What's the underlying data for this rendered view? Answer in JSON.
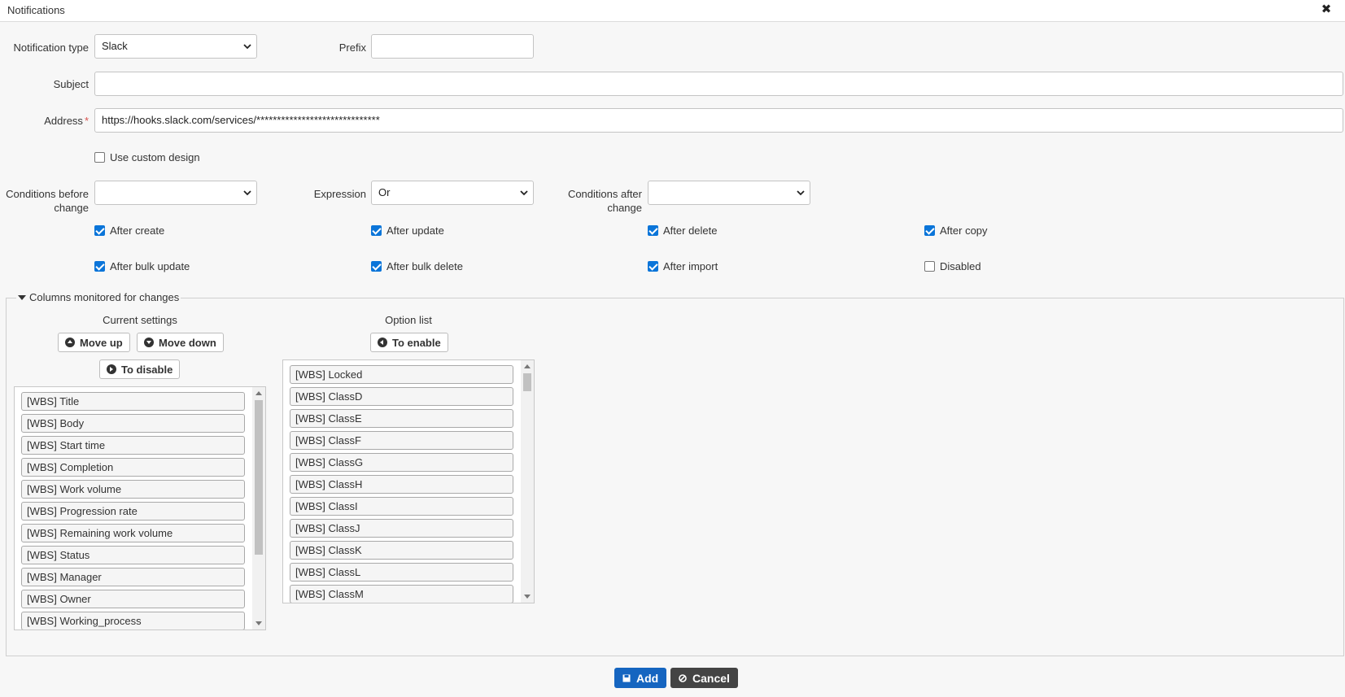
{
  "dialog": {
    "title": "Notifications",
    "close_icon": "close-icon"
  },
  "form": {
    "notification_type": {
      "label": "Notification type",
      "value": "Slack"
    },
    "prefix": {
      "label": "Prefix",
      "value": ""
    },
    "subject": {
      "label": "Subject",
      "value": ""
    },
    "address": {
      "label": "Address",
      "required_mark": "*",
      "value": "https://hooks.slack.com/services/******************************"
    },
    "custom_design": {
      "label": "Use custom design",
      "checked": false
    },
    "conditions_before": {
      "label_line1": "Conditions before",
      "label_line2": "change",
      "value": ""
    },
    "expression": {
      "label": "Expression",
      "value": "Or"
    },
    "conditions_after": {
      "label_line1": "Conditions after",
      "label_line2": "change",
      "value": ""
    },
    "triggers": [
      {
        "label": "After create",
        "checked": true
      },
      {
        "label": "After update",
        "checked": true
      },
      {
        "label": "After delete",
        "checked": true
      },
      {
        "label": "After copy",
        "checked": true
      },
      {
        "label": "After bulk update",
        "checked": true
      },
      {
        "label": "After bulk delete",
        "checked": true
      },
      {
        "label": "After import",
        "checked": true
      },
      {
        "label": "Disabled",
        "checked": false
      }
    ]
  },
  "columns": {
    "legend": "Columns monitored for changes",
    "current": {
      "caption": "Current settings",
      "move_up": "Move up",
      "move_down": "Move down",
      "to_disable": "To disable",
      "items": [
        "[WBS] Title",
        "[WBS] Body",
        "[WBS] Start time",
        "[WBS] Completion",
        "[WBS] Work volume",
        "[WBS] Progression rate",
        "[WBS] Remaining work volume",
        "[WBS] Status",
        "[WBS] Manager",
        "[WBS] Owner",
        "[WBS] Working_process"
      ]
    },
    "options": {
      "caption": "Option list",
      "to_enable": "To enable",
      "items": [
        "[WBS] Locked",
        "[WBS] ClassD",
        "[WBS] ClassE",
        "[WBS] ClassF",
        "[WBS] ClassG",
        "[WBS] ClassH",
        "[WBS] ClassI",
        "[WBS] ClassJ",
        "[WBS] ClassK",
        "[WBS] ClassL",
        "[WBS] ClassM"
      ]
    }
  },
  "actions": {
    "add": "Add",
    "cancel": "Cancel"
  },
  "colors": {
    "accent": "#0b75d9",
    "add_button": "#1565c0",
    "cancel_button": "#444444",
    "required": "#d9534f"
  }
}
